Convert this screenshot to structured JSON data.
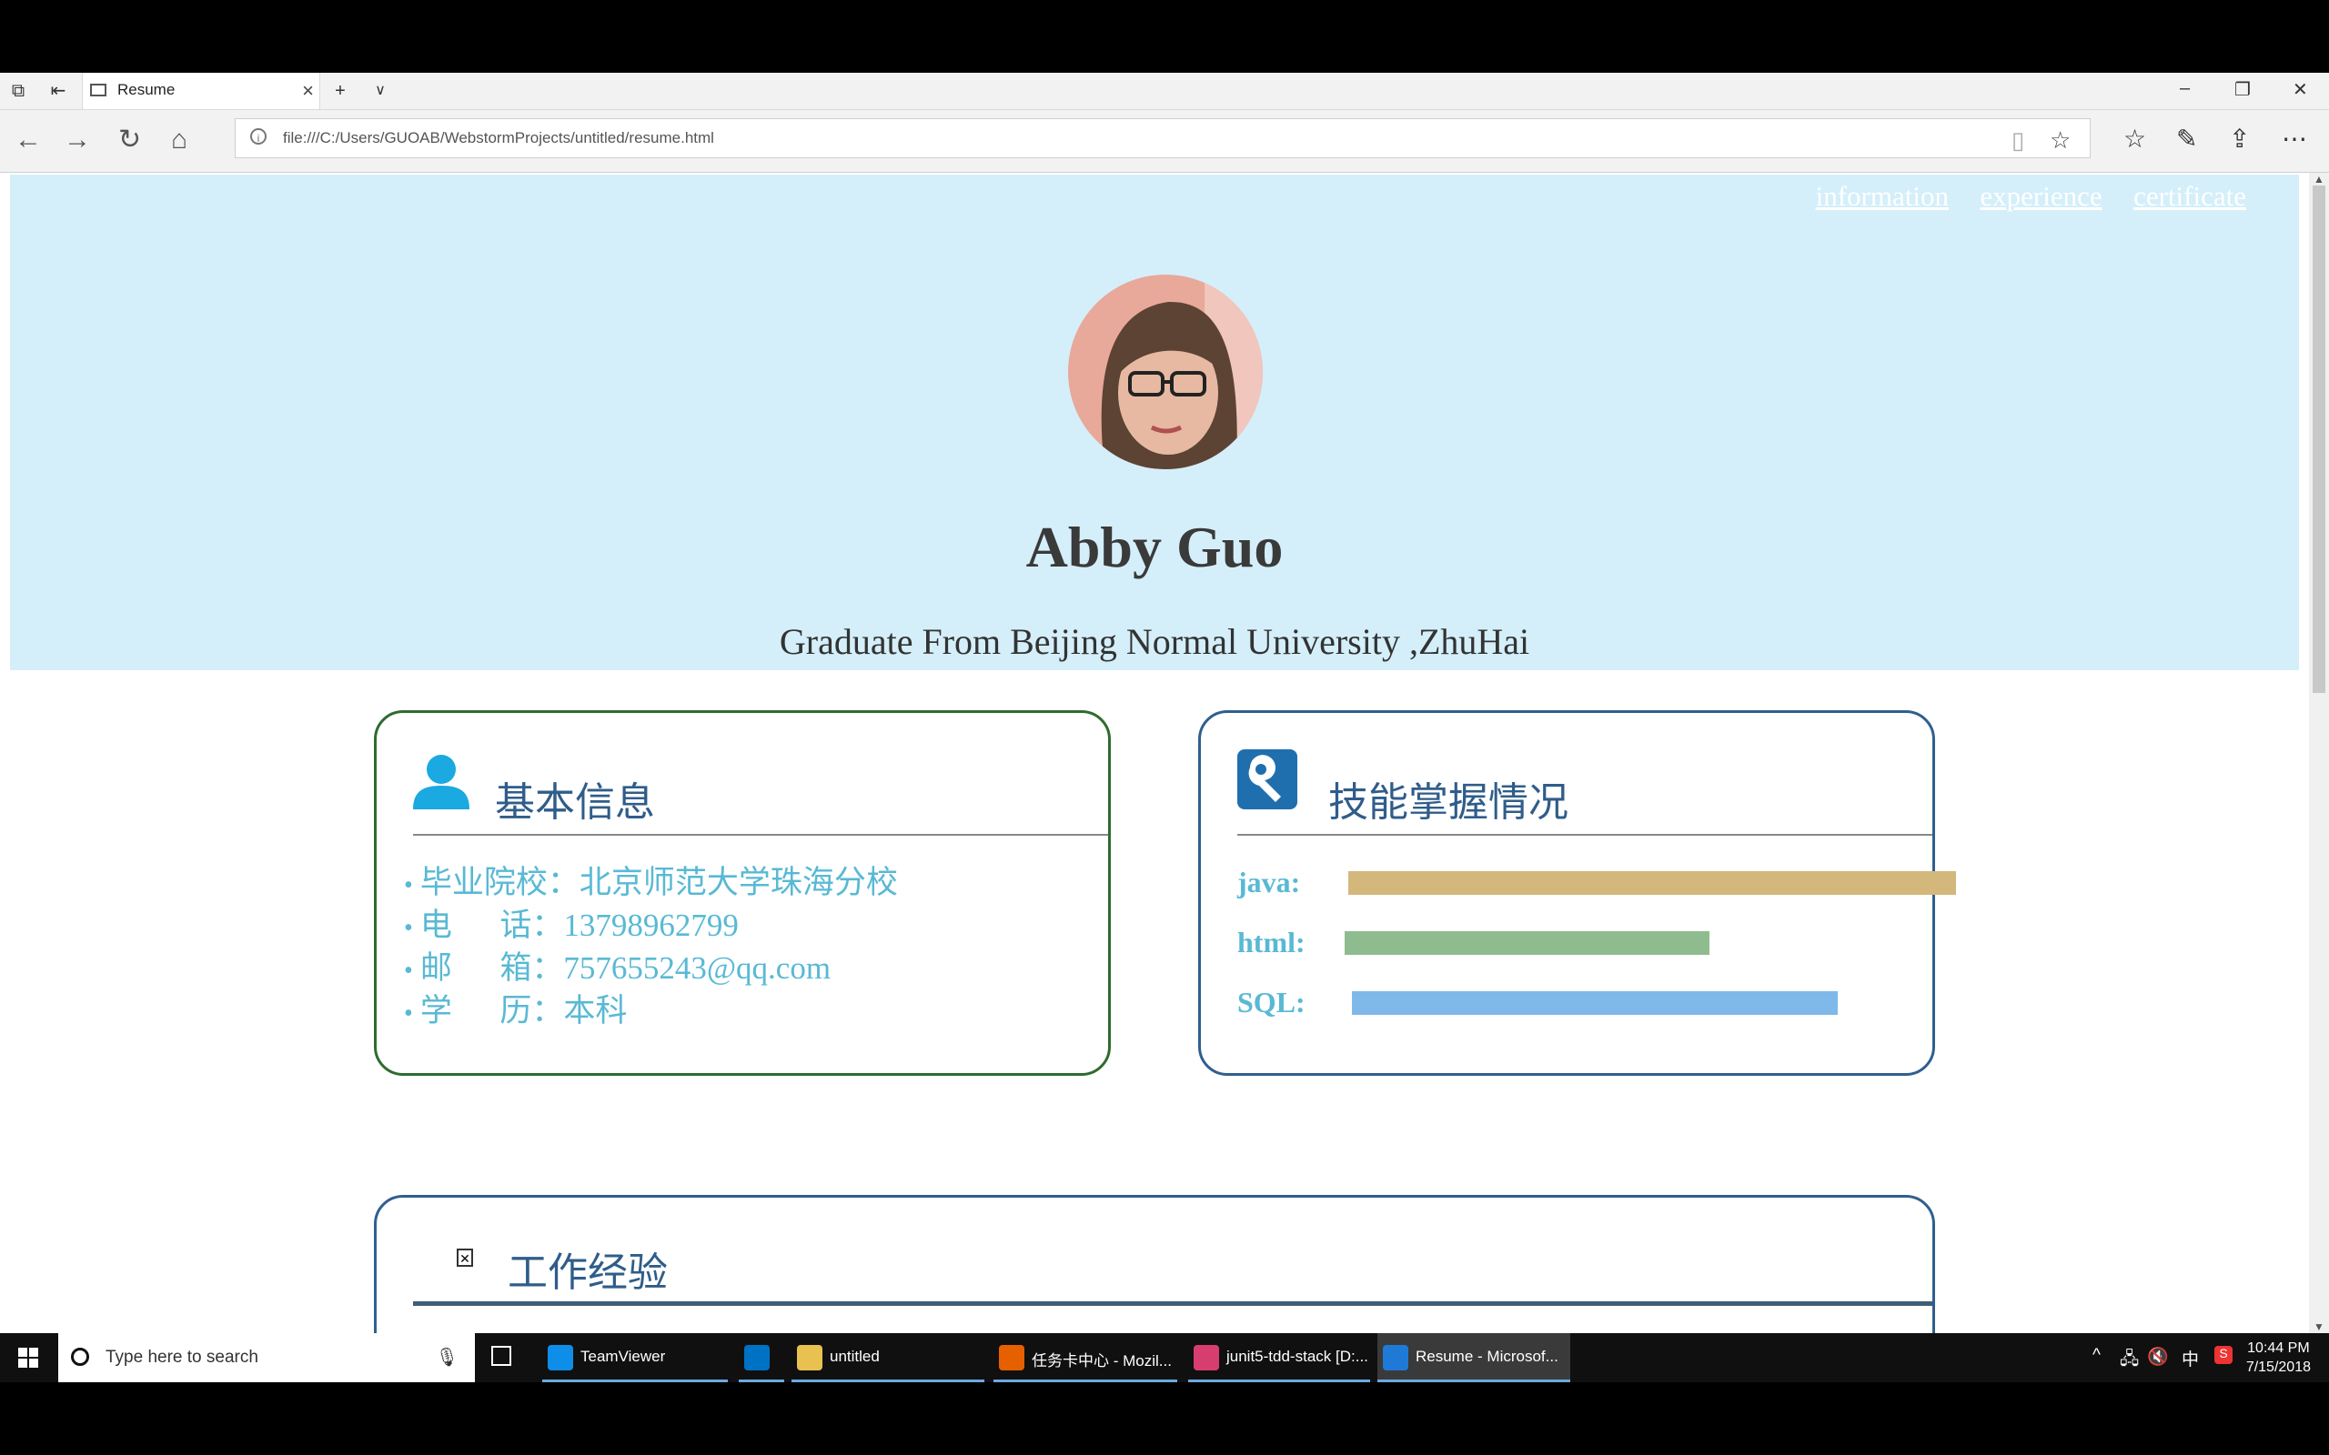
{
  "browser": {
    "tab_title": "Resume",
    "url": "file:///C:/Users/GUOAB/WebstormProjects/untitled/resume.html"
  },
  "page": {
    "nav": [
      "information",
      "experience",
      "certificate"
    ],
    "name": "Abby Guo",
    "subtitle": "Graduate From Beijing Normal University ,ZhuHai",
    "info_card": {
      "title": "基本信息",
      "items": [
        "毕业院校：北京师范大学珠海分校",
        "电      话：13798962799",
        "邮      箱：757655243@qq.com",
        "学      历：本科"
      ]
    },
    "skill_card": {
      "title": "技能掌握情况",
      "skills": [
        {
          "label": "java:",
          "level": 1.0,
          "color": "#d4b77b"
        },
        {
          "label": "html:",
          "level": 0.6,
          "color": "#8fbc8f"
        },
        {
          "label": "SQL:",
          "level": 0.8,
          "color": "#7eb9ea"
        }
      ]
    },
    "work_card": {
      "title": "工作经验"
    }
  },
  "taskbar": {
    "search_placeholder": "Type here to search",
    "items": [
      {
        "label": "TeamViewer",
        "color": "#0e8ee9"
      },
      {
        "label": "",
        "color": "#0072c6"
      },
      {
        "label": "untitled",
        "color": "#e8c150"
      },
      {
        "label": "任务卡中心 - Mozil...",
        "color": "#e66000"
      },
      {
        "label": "junit5-tdd-stack [D:...",
        "color": "#d73e6f"
      },
      {
        "label": "Resume - Microsof...",
        "color": "#1e7ad6"
      }
    ],
    "time": "10:44 PM",
    "date": "7/15/2018",
    "ime": "中"
  }
}
